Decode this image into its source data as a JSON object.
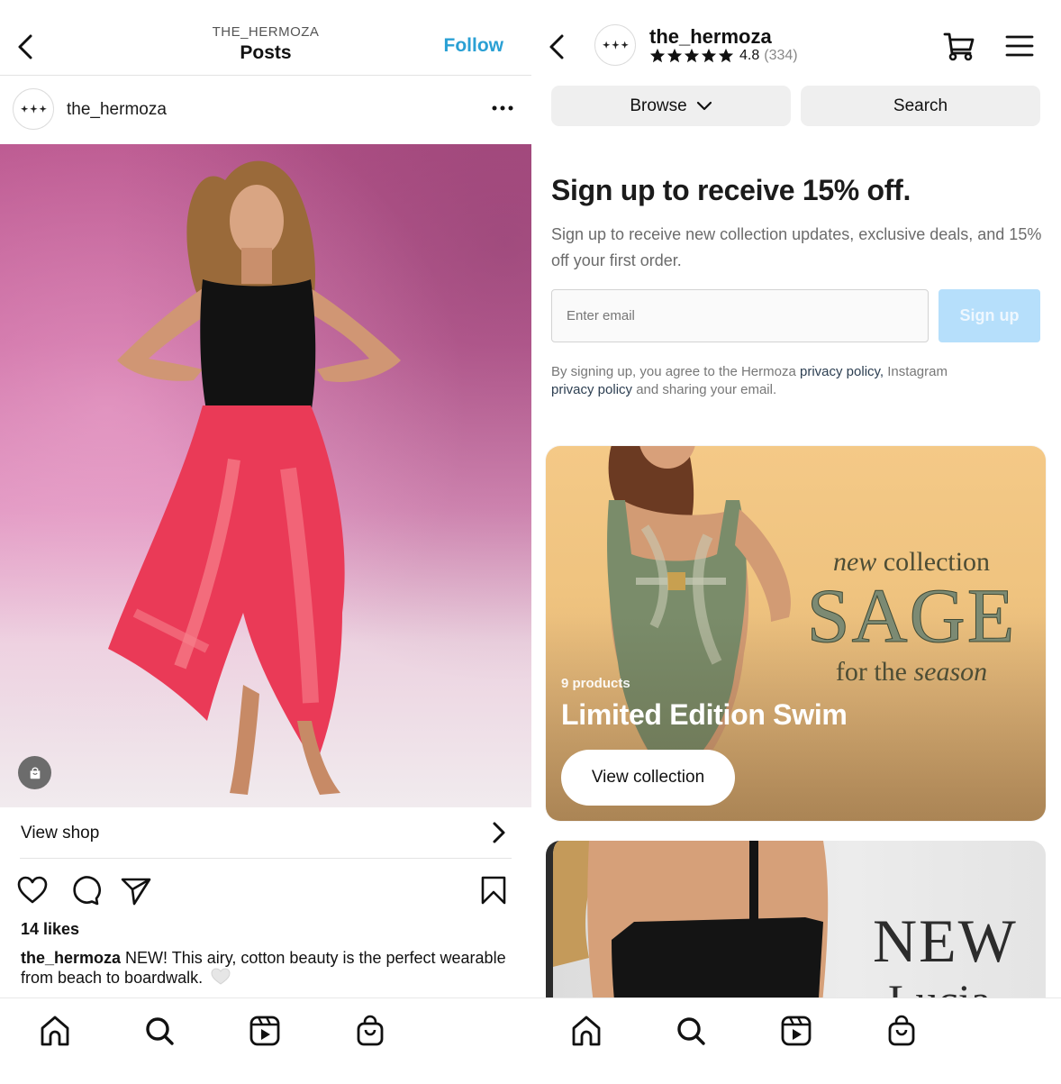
{
  "post_view": {
    "header": {
      "overtitle": "THE_HERMOZA",
      "title": "Posts",
      "follow_label": "Follow",
      "back_icon": "chevron-left-icon"
    },
    "author": {
      "username": "the_hermoza",
      "avatar_icon": "three-sparkles-logo",
      "more_icon": "more-horizontal-icon"
    },
    "image": {
      "description": "Model in black one-piece swimsuit wearing red-pink leaf-print sarong on pink backdrop",
      "shop_tag_icon": "shopping-bag-icon"
    },
    "view_shop_label": "View shop",
    "actions": [
      "heart-icon",
      "comment-icon",
      "share-icon",
      "bookmark-icon"
    ],
    "likes": "14 likes",
    "caption": {
      "username": "the_hermoza",
      "text": " NEW! This airy, cotton beauty is the perfect wearable from beach to boardwalk."
    }
  },
  "shop_view": {
    "header": {
      "shop_name": "the_hermoza",
      "rating_stars": 5,
      "rating_value": "4.8",
      "rating_count": "(334)",
      "cart_icon": "cart-icon",
      "menu_icon": "hamburger-menu-icon"
    },
    "browse_label": "Browse",
    "search_label": "Search",
    "signup": {
      "title": "Sign up to receive 15% off.",
      "description": "Sign up to receive new collection updates, exclusive deals, and 15% off your first order.",
      "email_placeholder": "Enter email",
      "email_value": "",
      "button_label": "Sign up",
      "legal_prefix": "By signing up, you agree to the Hermoza ",
      "legal_link1": "privacy policy,",
      "legal_mid": " Instagram ",
      "legal_link2": "privacy policy",
      "legal_suffix": " and sharing your email."
    },
    "collections": [
      {
        "count": "9 products",
        "title": "Limited Edition Swim",
        "button_label": "View collection",
        "art_top_italic": "new",
        "art_top": " collection",
        "art_main": "SAGE",
        "art_bottom": "for the ",
        "art_bottom_italic": "season"
      },
      {
        "art_main": "NEW",
        "art_sub": "Lucia"
      }
    ]
  },
  "bottom_nav": {
    "items": [
      {
        "name": "home",
        "icon": "home-icon"
      },
      {
        "name": "search",
        "icon": "search-icon"
      },
      {
        "name": "reels",
        "icon": "reels-icon"
      },
      {
        "name": "shop",
        "icon": "shopping-bag-icon"
      }
    ]
  },
  "colors": {
    "follow_blue": "#2aa0d4",
    "signup_button_disabled": "#b6dffb",
    "link_dark": "#2d3f52",
    "pill_gray": "#efefef"
  }
}
